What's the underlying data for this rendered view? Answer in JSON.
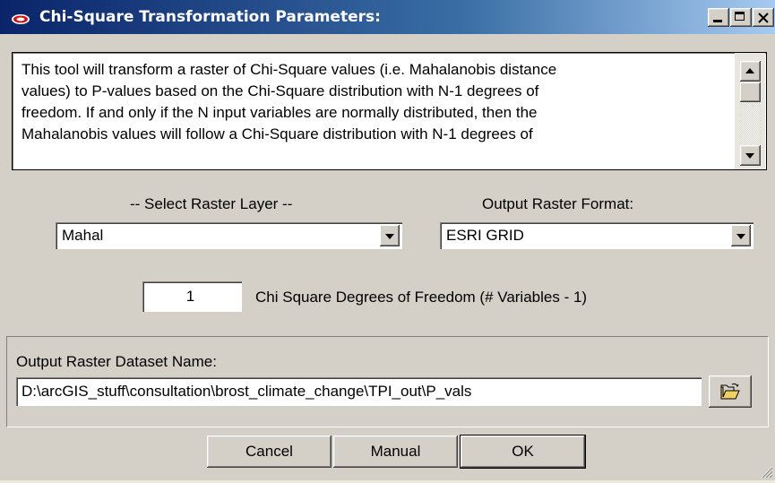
{
  "window": {
    "title": "Chi-Square Transformation Parameters:",
    "icon": "eye-icon",
    "controls": [
      "minimize-icon",
      "maximize-icon",
      "close-icon"
    ]
  },
  "description": {
    "lines": [
      "This tool will transform a raster of Chi-Square values (i.e. Mahalanobis distance",
      "values) to P-values based on the Chi-Square distribution with N-1 degrees of",
      "freedom.  If and only if the N input variables are normally distributed, then the",
      "Mahalanobis values will follow a Chi-Square distribution with N-1 degrees of"
    ]
  },
  "raster_layer": {
    "label": "-- Select Raster Layer --",
    "selected": "Mahal"
  },
  "output_format": {
    "label": "Output Raster Format:",
    "selected": "ESRI GRID"
  },
  "degrees_of_freedom": {
    "value": "1",
    "label": "Chi Square Degrees of Freedom (# Variables - 1)"
  },
  "output_dataset": {
    "label": "Output Raster Dataset Name:",
    "value": "D:\\arcGIS_stuff\\consultation\\brost_climate_change\\TPI_out\\P_vals",
    "browse_icon": "folder-open-icon"
  },
  "buttons": {
    "cancel": "Cancel",
    "manual": "Manual",
    "ok": "OK"
  }
}
